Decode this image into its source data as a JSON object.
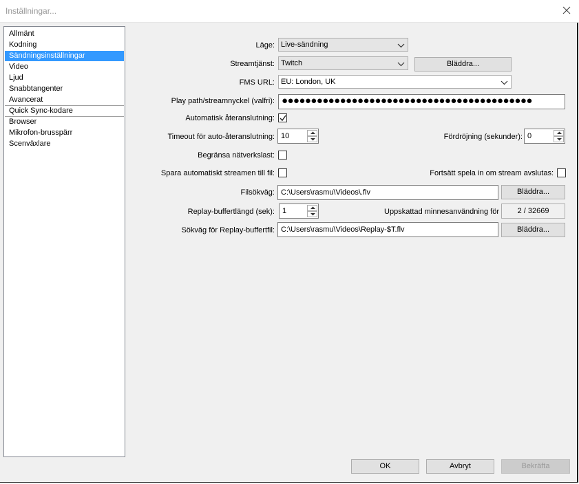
{
  "window": {
    "title": "Inställningar..."
  },
  "sidebar": {
    "items": [
      {
        "label": "Allmänt"
      },
      {
        "label": "Kodning"
      },
      {
        "label": "Sändningsinställningar"
      },
      {
        "label": "Video"
      },
      {
        "label": "Ljud"
      },
      {
        "label": "Snabbtangenter"
      },
      {
        "label": "Avancerat"
      },
      {
        "label": "Quick Sync-kodare"
      },
      {
        "label": "Browser"
      },
      {
        "label": "Mikrofon-brusspärr"
      },
      {
        "label": "Scenväxlare"
      }
    ],
    "selected": "Sändningsinställningar"
  },
  "form": {
    "mode": {
      "label": "Läge:",
      "value": "Live-sändning"
    },
    "service": {
      "label": "Streamtjänst:",
      "value": "Twitch",
      "browse": "Bläddra..."
    },
    "fms": {
      "label": "FMS URL:",
      "value": "EU: London, UK"
    },
    "streamkey": {
      "label": "Play path/streamnyckel (valfri):",
      "value": "●●●●●●●●●●●●●●●●●●●●●●●●●●●●●●●●●●●●●●●●●●●"
    },
    "autoreconnect": {
      "label": "Automatisk återanslutning:",
      "checked": true
    },
    "timeout": {
      "label": "Timeout för auto-återanslutning:",
      "value": "10"
    },
    "delay": {
      "label": "Fördröjning (sekunder):",
      "value": "0"
    },
    "limitnet": {
      "label": "Begränsa nätverkslast:",
      "checked": false
    },
    "autosave": {
      "label": "Spara automatiskt streamen till fil:",
      "checked": false
    },
    "keepplaying": {
      "label": "Fortsätt spela in om stream avslutas:",
      "checked": false
    },
    "filepath": {
      "label": "Filsökväg:",
      "value": "C:\\Users\\rasmu\\Videos\\.flv",
      "browse": "Bläddra..."
    },
    "replaylen": {
      "label": "Replay-buffertlängd (sek):",
      "value": "1"
    },
    "memory": {
      "label": "Uppskattad minnesanvändning för",
      "value": "2 / 32669"
    },
    "replaypath": {
      "label": "Sökväg för Replay-buffertfil:",
      "value": "C:\\Users\\rasmu\\Videos\\Replay-$T.flv",
      "browse": "Bläddra..."
    }
  },
  "footer": {
    "ok": "OK",
    "cancel": "Avbryt",
    "apply": "Bekräfta"
  }
}
